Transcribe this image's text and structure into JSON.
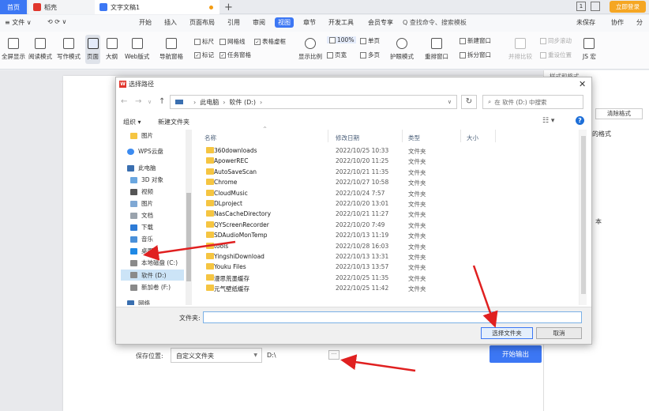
{
  "tabs": {
    "home": "首页",
    "daoke": "稻壳",
    "doc": "文字文稿1",
    "add": "+",
    "login": "立即登录"
  },
  "menu": {
    "file": "≡ 文件 ∨",
    "items": [
      "开始",
      "插入",
      "页面布局",
      "引用",
      "审阅",
      "视图",
      "章节",
      "开发工具",
      "会员专享"
    ],
    "search": "Q 查找命令、搜索模板",
    "save": "未保存",
    "collab": "协作",
    "share": "分"
  },
  "ribbon": {
    "buttons": [
      "全屏显示",
      "阅读模式",
      "写作模式",
      "页面",
      "大纲",
      "Web版式",
      "导航窗格",
      "显示比例",
      "100%",
      "页宽",
      "单页",
      "多页",
      "护眼模式",
      "重排窗口",
      "新建窗口",
      "拆分窗口",
      "并排比较",
      "同步滚动",
      "重设位置",
      "JS 宏"
    ],
    "checks": {
      "ruler": "标尺",
      "grid": "网格线",
      "table_lines": "表格虚框",
      "mark": "标记",
      "task_pane": "任务窗格"
    }
  },
  "dialog": {
    "title": "选择路径",
    "breadcrumb": [
      "此电脑",
      "软件 (D:)"
    ],
    "search_placeholder": "在 软件 (D:) 中搜索",
    "organize": "组织 ▾",
    "new_folder": "新建文件夹",
    "help": "?",
    "tree": [
      "图片",
      "WPS云盘",
      "此电脑",
      "3D 对象",
      "视频",
      "图片",
      "文档",
      "下载",
      "音乐",
      "桌面",
      "本地磁盘 (C:)",
      "软件 (D:)",
      "新加卷 (F:)",
      "网络"
    ],
    "columns": {
      "name": "名称",
      "date": "修改日期",
      "type": "类型",
      "size": "大小"
    },
    "files": [
      {
        "name": "360downloads",
        "date": "2022/10/25 10:33",
        "type": "文件夹"
      },
      {
        "name": "ApowerREC",
        "date": "2022/10/20 11:25",
        "type": "文件夹"
      },
      {
        "name": "AutoSaveScan",
        "date": "2022/10/21 11:35",
        "type": "文件夹"
      },
      {
        "name": "Chrome",
        "date": "2022/10/27 10:58",
        "type": "文件夹"
      },
      {
        "name": "CloudMusic",
        "date": "2022/10/24 7:57",
        "type": "文件夹"
      },
      {
        "name": "DLproject",
        "date": "2022/10/20 13:01",
        "type": "文件夹"
      },
      {
        "name": "NasCacheDirectory",
        "date": "2022/10/21 11:27",
        "type": "文件夹"
      },
      {
        "name": "QYScreenRecorder",
        "date": "2022/10/20 7:49",
        "type": "文件夹"
      },
      {
        "name": "SDAudioMonTemp",
        "date": "2022/10/13 11:19",
        "type": "文件夹"
      },
      {
        "name": "tools",
        "date": "2022/10/28 16:03",
        "type": "文件夹"
      },
      {
        "name": "YingshiDownload",
        "date": "2022/10/13 13:31",
        "type": "文件夹"
      },
      {
        "name": "Youku Files",
        "date": "2022/10/13 13:57",
        "type": "文件夹"
      },
      {
        "name": "漫思荒墨缓存",
        "date": "2022/10/25 11:35",
        "type": "文件夹"
      },
      {
        "name": "元气壁纸缓存",
        "date": "2022/10/25 11:42",
        "type": "文件夹"
      }
    ],
    "folder_label": "文件夹:",
    "folder_value": "",
    "ok": "选择文件夹",
    "cancel": "取消"
  },
  "export": {
    "save_label": "保存位置:",
    "location": "自定义文件夹",
    "path": "D:\\",
    "more": "···",
    "start": "开始输出"
  },
  "side_panel": {
    "label": "样式和格式",
    "clear": "清除格式",
    "heading": "的格式",
    "side_char": "本"
  },
  "colors": {
    "accent": "#3c77f4",
    "arrow": "#e02020",
    "folder": "#f5c542"
  }
}
